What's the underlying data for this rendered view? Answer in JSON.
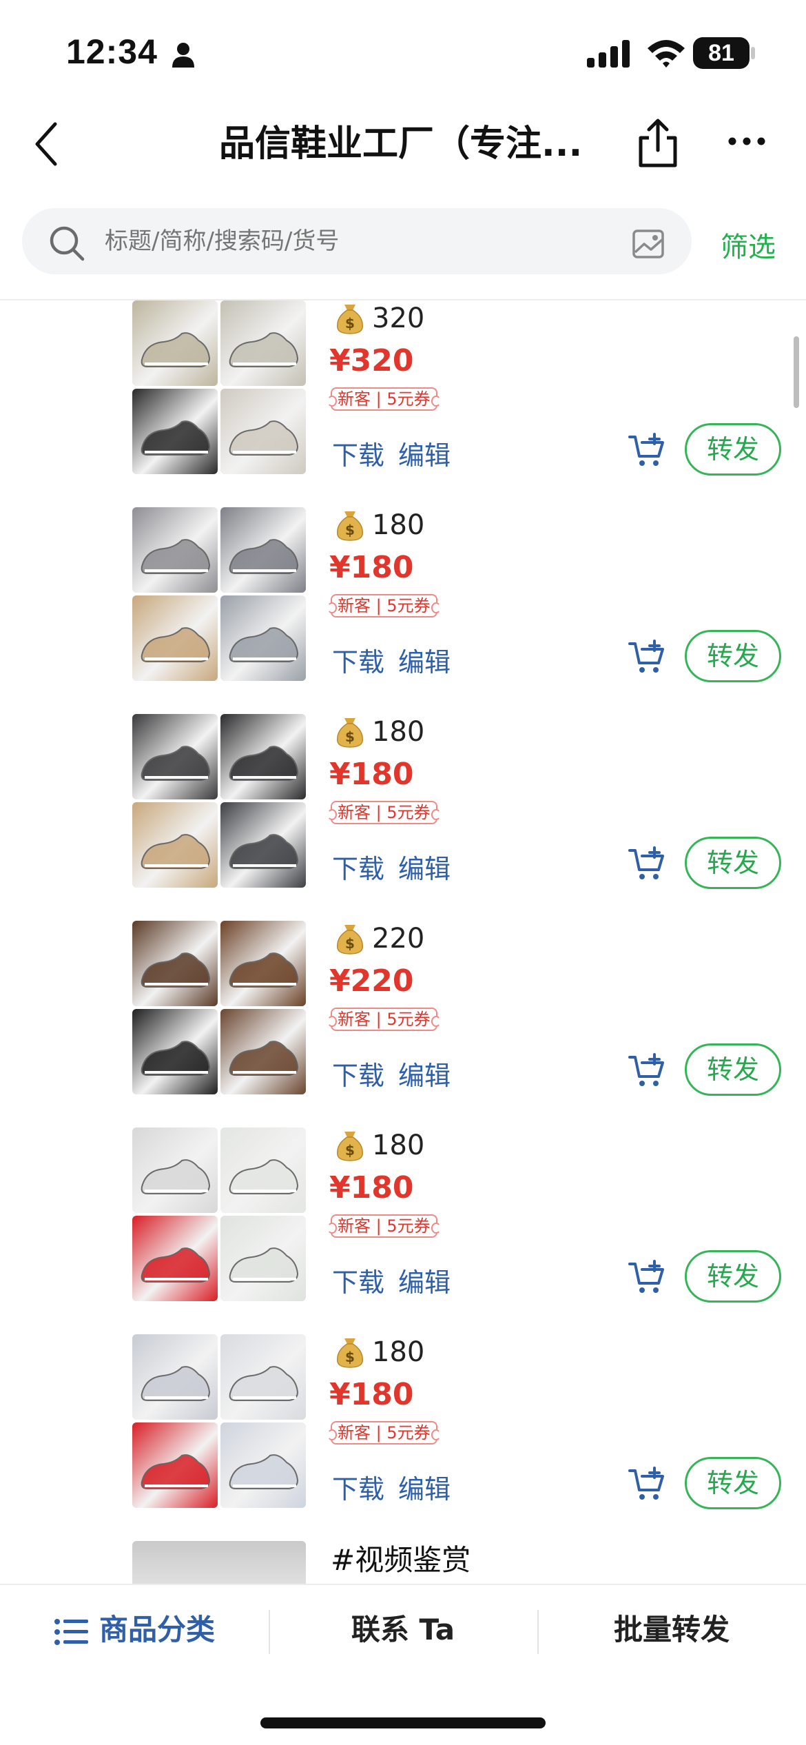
{
  "status_bar": {
    "time": "12:34",
    "battery": "81"
  },
  "nav": {
    "title": "品信鞋业工厂（专注...",
    "back_icon": "chevron-left-icon",
    "share_icon": "share-icon",
    "more_icon": "more-dots-icon"
  },
  "search": {
    "placeholder": "标题/简称/搜索码/货号",
    "filter_label": "筛选"
  },
  "colors": {
    "price_red": "#e0362c",
    "link_blue": "#2f5fa8",
    "accent_green": "#28a84e"
  },
  "products": [
    {
      "price_text": "320",
      "price": "¥320",
      "coupon": "新客 | 5元券",
      "download": "下载",
      "edit": "编辑",
      "forward": "转发",
      "palette": [
        "#bdb59e",
        "#c4c0b4",
        "#2a2a2a",
        "#cfcac0"
      ]
    },
    {
      "price_text": "180",
      "price": "¥180",
      "coupon": "新客 | 5元券",
      "download": "下载",
      "edit": "编辑",
      "forward": "转发",
      "palette": [
        "#8e8e93",
        "#7d8087",
        "#c8a77c",
        "#9aa0a8"
      ]
    },
    {
      "price_text": "180",
      "price": "¥180",
      "coupon": "新客 | 5元券",
      "download": "下载",
      "edit": "编辑",
      "forward": "转发",
      "palette": [
        "#3a3a3c",
        "#2b2b2d",
        "#c8a77c",
        "#3d3f44"
      ]
    },
    {
      "price_text": "220",
      "price": "¥220",
      "coupon": "新客 | 5元券",
      "download": "下载",
      "edit": "编辑",
      "forward": "转发",
      "palette": [
        "#5b3a26",
        "#6b4126",
        "#1f1f1f",
        "#6a4630"
      ]
    },
    {
      "price_text": "180",
      "price": "¥180",
      "coupon": "新客 | 5元券",
      "download": "下载",
      "edit": "编辑",
      "forward": "转发",
      "palette": [
        "#d8d8d8",
        "#e4e6e2",
        "#d81f26",
        "#dfe3de"
      ]
    },
    {
      "price_text": "180",
      "price": "¥180",
      "coupon": "新客 | 5元券",
      "download": "下载",
      "edit": "编辑",
      "forward": "转发",
      "palette": [
        "#c7cbd3",
        "#d9dbe0",
        "#d81f26",
        "#cfd4dd"
      ]
    }
  ],
  "video_item": {
    "title": "#视频鉴赏"
  },
  "tabbar": {
    "categories": "商品分类",
    "contact": "联系 Ta",
    "batch_forward": "批量转发"
  }
}
